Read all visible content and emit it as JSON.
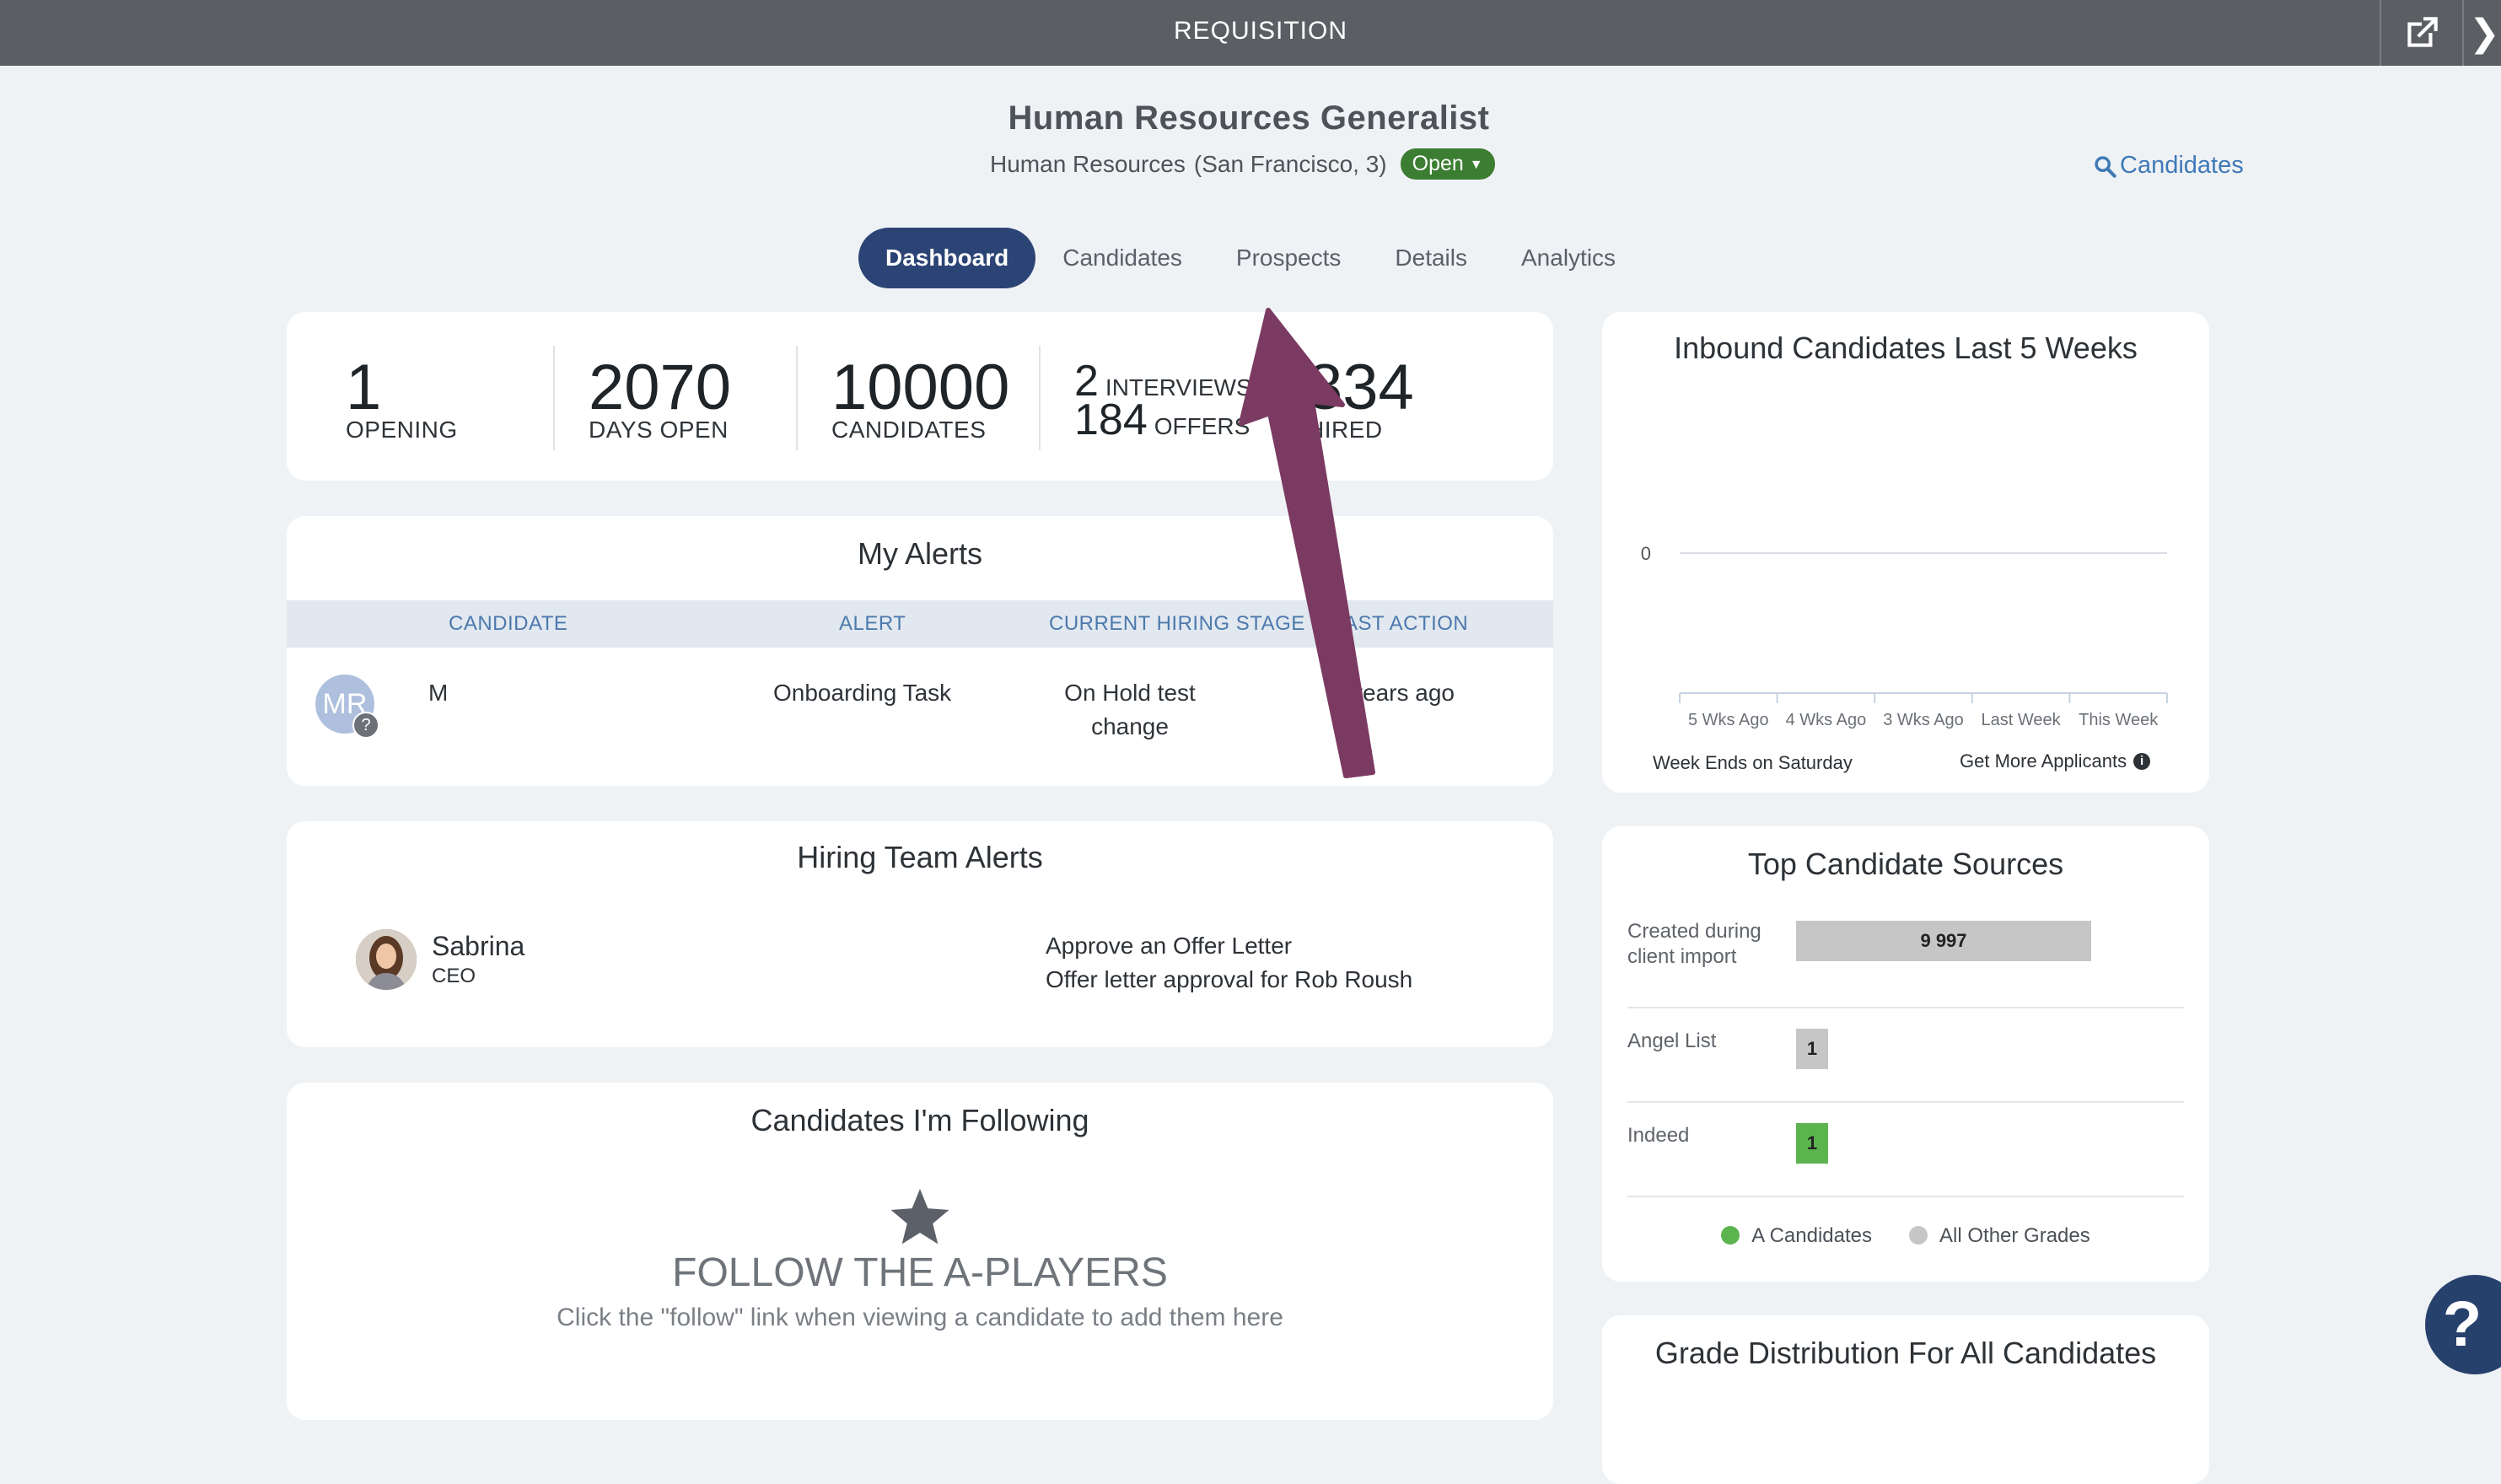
{
  "window": {
    "title": "REQUISITION"
  },
  "job": {
    "title": "Human Resources Generalist",
    "department": "Human Resources",
    "location": "(San Francisco, 3)",
    "status": "Open"
  },
  "search": {
    "label": "Candidates"
  },
  "tabs": [
    {
      "label": "Dashboard",
      "active": true
    },
    {
      "label": "Candidates"
    },
    {
      "label": "Prospects"
    },
    {
      "label": "Details"
    },
    {
      "label": "Analytics"
    }
  ],
  "stats": {
    "opening": {
      "value": "1",
      "label": "OPENING"
    },
    "days_open": {
      "value": "2070",
      "label": "DAYS OPEN"
    },
    "candidates": {
      "value": "10000",
      "label": "CANDIDATES"
    },
    "interviews": {
      "value": "2",
      "label": "INTERVIEWS"
    },
    "offers": {
      "value": "184",
      "label": "OFFERS"
    },
    "hired": {
      "value": "834",
      "label": "HIRED"
    }
  },
  "my_alerts": {
    "title": "My Alerts",
    "columns": [
      "CANDIDATE",
      "ALERT",
      "CURRENT HIRING STAGE",
      "AST ACTION"
    ],
    "rows": [
      {
        "initials": "MR",
        "candidate": "M",
        "alert": "Onboarding Task",
        "stage_line1": "On Hold test",
        "stage_line2": "change",
        "last_action": "years ago"
      }
    ]
  },
  "hiring_team_alerts": {
    "title": "Hiring Team Alerts",
    "person_name": "Sabrina",
    "person_role": "CEO",
    "alert_title": "Approve an Offer Letter",
    "alert_detail": "Offer letter approval for Rob Roush"
  },
  "following": {
    "title": "Candidates I'm Following",
    "heading": "FOLLOW THE A-PLAYERS",
    "text": "Click the \"follow\" link when viewing a candidate to add them here"
  },
  "inbound": {
    "title": "Inbound Candidates Last 5 Weeks",
    "footer_left": "Week Ends on Saturday",
    "footer_right": "Get More Applicants"
  },
  "chart_data": {
    "type": "line",
    "title": "Inbound Candidates Last 5 Weeks",
    "categories": [
      "5 Wks Ago",
      "4 Wks Ago",
      "3 Wks Ago",
      "Last Week",
      "This Week"
    ],
    "series": [
      {
        "values": [
          0,
          0,
          0,
          0,
          0
        ]
      }
    ],
    "y_ticks": [
      "0"
    ]
  },
  "sources": {
    "title": "Top Candidate Sources",
    "rows": [
      {
        "name": "Created during client import",
        "value": "9 997",
        "fraction": 1.0,
        "color": "#c6c6c6"
      },
      {
        "name": "Angel List",
        "value": "1",
        "fraction": 0.0001,
        "color": "#c6c6c6"
      },
      {
        "name": "Indeed",
        "value": "1",
        "fraction": 0.0001,
        "color": "#5cb44f"
      }
    ],
    "legend": [
      {
        "label": "A Candidates",
        "color": "#5cb44f"
      },
      {
        "label": "All Other Grades",
        "color": "#c6c6c6"
      }
    ]
  },
  "grade": {
    "title": "Grade Distribution For All Candidates"
  },
  "help": {
    "label": "?"
  },
  "colors": {
    "accent": "#2c4475",
    "link": "#3f79b7",
    "status": "#3b7d31",
    "annotation_arrow": "#7b3a62"
  }
}
